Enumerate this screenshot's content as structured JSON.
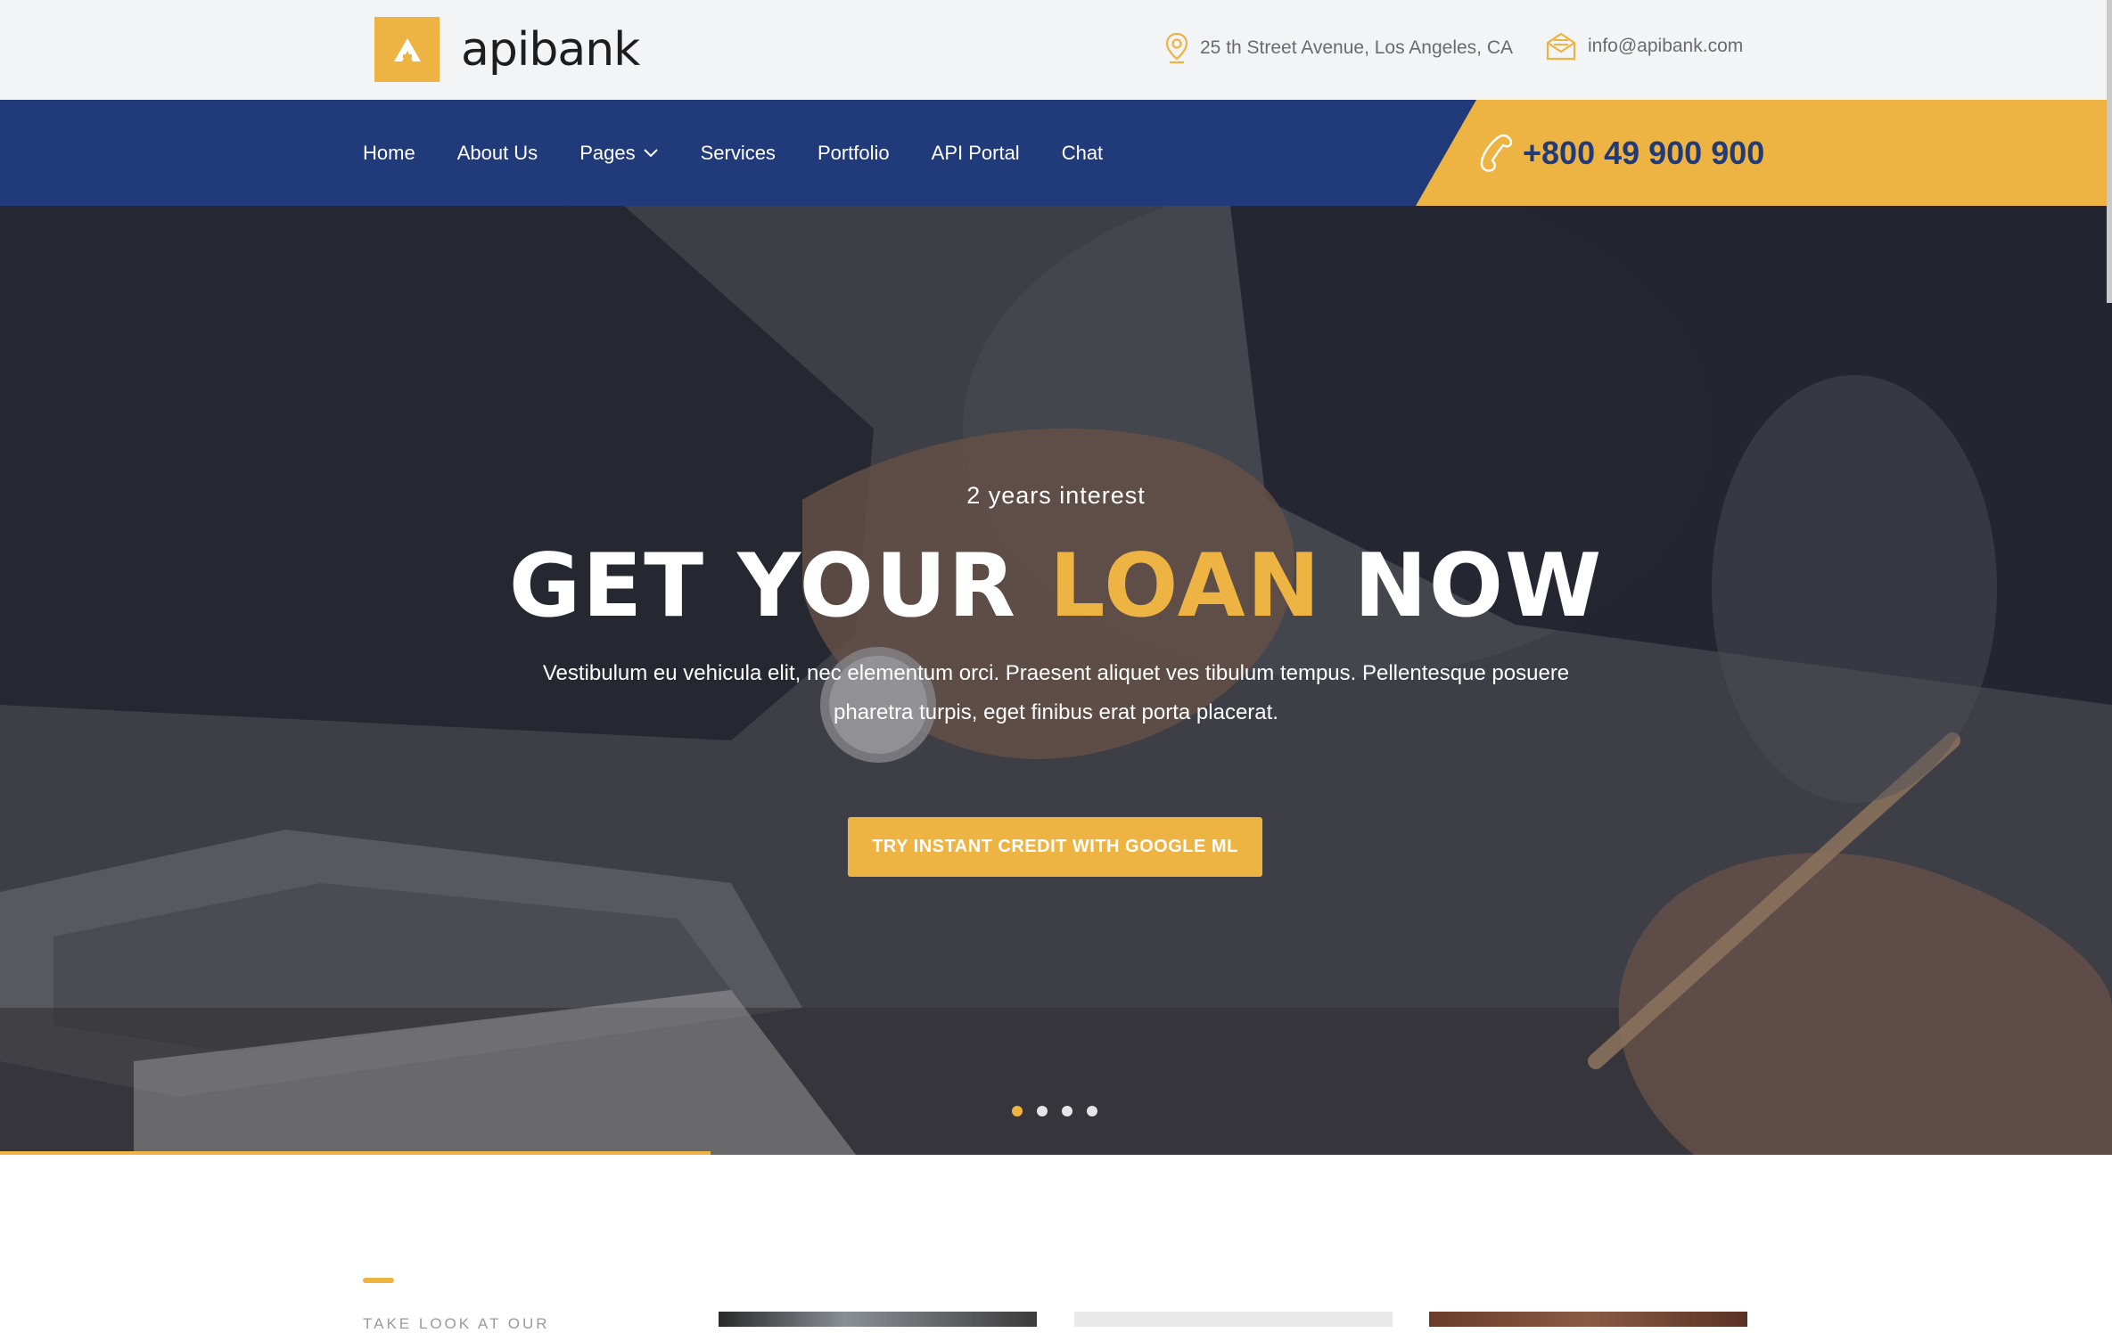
{
  "brand": {
    "name": "apibank",
    "logo_letter": "A",
    "accent_color": "#eeb443",
    "nav_color": "#213a7a"
  },
  "topbar": {
    "address": "25 th Street Avenue, Los Angeles, CA",
    "address_icon": "map-pin-icon",
    "email": "info@apibank.com",
    "email_icon": "envelope-icon"
  },
  "nav": {
    "items": [
      {
        "label": "Home"
      },
      {
        "label": "About Us"
      },
      {
        "label": "Pages",
        "has_dropdown": true
      },
      {
        "label": "Services"
      },
      {
        "label": "Portfolio"
      },
      {
        "label": "API Portal"
      },
      {
        "label": "Chat"
      }
    ],
    "phone": "+800 49 900 900",
    "phone_icon": "phone-icon"
  },
  "hero": {
    "subtitle": "2 years interest",
    "title_part1": "GET YOUR ",
    "title_accent": "LOAN",
    "title_part2": " NOW",
    "description": "Vestibulum eu vehicula elit, nec elementum orci. Praesent aliquet ves tibulum tempus. Pellentesque posuere pharetra turpis, eget finibus erat porta placerat.",
    "button_label": "TRY INSTANT CREDIT WITH GOOGLE ML",
    "slides_total": 4,
    "active_slide": 1
  },
  "section": {
    "label": "TAKE LOOK AT OUR"
  }
}
